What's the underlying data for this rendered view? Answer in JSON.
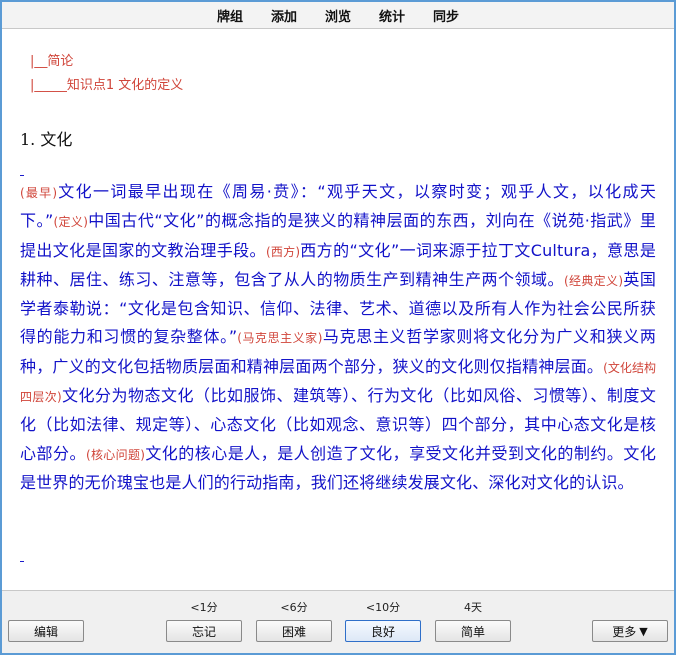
{
  "menu": {
    "items": [
      "牌组",
      "添加",
      "浏览",
      "统计",
      "同步"
    ]
  },
  "breadcrumbs": [
    "|__简论",
    "|_____知识点1 文化的定义"
  ],
  "section_title": "1. 文化",
  "paragraph": [
    {
      "kind": "tag",
      "text": "(最早)"
    },
    {
      "kind": "text",
      "text": "文化一词最早出现在《周易·贲》：“观乎天文，以察时变；观乎人文，以化成天下。”"
    },
    {
      "kind": "tag",
      "text": "(定义)"
    },
    {
      "kind": "text",
      "text": "中国古代“文化”的概念指的是狭义的精神层面的东西，刘向在《说苑·指武》里提出文化是国家的文教治理手段。"
    },
    {
      "kind": "tag",
      "text": "(西方)"
    },
    {
      "kind": "text",
      "text": "西方的“文化”一词来源于拉丁文Cultura，意思是耕种、居住、练习、注意等，包含了从人的物质生产到精神生产两个领域。"
    },
    {
      "kind": "tag",
      "text": "(经典定义)"
    },
    {
      "kind": "text",
      "text": "英国学者泰勒说：“文化是包含知识、信仰、法律、艺术、道德以及所有人作为社会公民所获得的能力和习惯的复杂整体。”"
    },
    {
      "kind": "tag",
      "text": "(马克思主义家)"
    },
    {
      "kind": "text",
      "text": "马克思主义哲学家则将文化分为广义和狭义两种，广义的文化包括物质层面和精神层面两个部分，狭义的文化则仅指精神层面。"
    },
    {
      "kind": "tag",
      "text": "(文化结构四层次)"
    },
    {
      "kind": "text",
      "text": "文化分为物态文化（比如服饰、建筑等）、行为文化（比如风俗、习惯等）、制度文化（比如法律、规定等）、心态文化（比如观念、意识等）四个部分，其中心态文化是核心部分。"
    },
    {
      "kind": "tag",
      "text": "(核心问题)"
    },
    {
      "kind": "text",
      "text": "文化的核心是人，是人创造了文化，享受文化并受到文化的制约。文化是世界的无价瑰宝也是人们的行动指南，我们还将继续发展文化、深化对文化的认识。"
    }
  ],
  "bottom": {
    "edit_label": "编辑",
    "answers": [
      {
        "interval": "<1分",
        "label": "忘记"
      },
      {
        "interval": "<6分",
        "label": "困难"
      },
      {
        "interval": "<10分",
        "label": "良好"
      },
      {
        "interval": "4天",
        "label": "简单"
      }
    ],
    "more_label": "更多",
    "more_arrow": "▼"
  },
  "colors": {
    "body_text": "#1212c8",
    "tag_text": "#d0453a",
    "window_border": "#5b9bd5"
  }
}
